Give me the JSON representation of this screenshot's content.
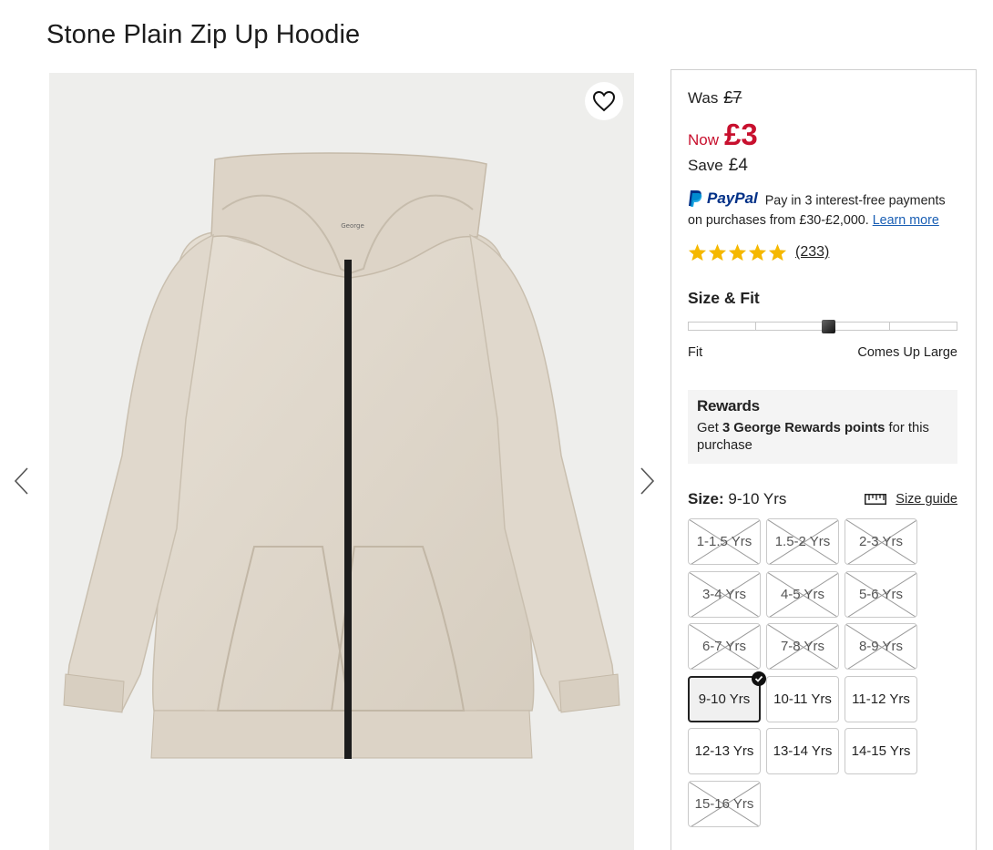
{
  "product": {
    "title": "Stone Plain Zip Up Hoodie",
    "brand_tag": "George"
  },
  "gallery": {
    "favourite_icon": "heart-icon",
    "prev_icon": "chevron-left-icon",
    "next_icon": "chevron-right-icon"
  },
  "price": {
    "was_label": "Was",
    "was_value": "£7",
    "now_label": "Now",
    "now_value": "£3",
    "save_label": "Save",
    "save_value": "£4",
    "sale_color": "#c8102e"
  },
  "paypal": {
    "logo_text": "PayPal",
    "message_line1": "Pay in 3 interest-free payments",
    "message_line2": "on purchases from £30-£2,000.",
    "link": "Learn more"
  },
  "rating": {
    "stars": 5,
    "count": "(233)",
    "star_color": "#f5b800"
  },
  "fit": {
    "title": "Size & Fit",
    "left_label": "Fit",
    "right_label": "Comes Up Large",
    "position_fraction": 0.52
  },
  "rewards": {
    "title": "Rewards",
    "text_pre": "Get ",
    "text_bold": "3 George Rewards points",
    "text_post": " for this purchase"
  },
  "size": {
    "label": "Size:",
    "selected": "9-10 Yrs",
    "guide_label": "Size guide",
    "guide_icon": "ruler-icon",
    "options": [
      {
        "label": "1-1.5 Yrs",
        "available": false
      },
      {
        "label": "1.5-2 Yrs",
        "available": false
      },
      {
        "label": "2-3 Yrs",
        "available": false
      },
      {
        "label": "3-4 Yrs",
        "available": false
      },
      {
        "label": "4-5 Yrs",
        "available": false
      },
      {
        "label": "5-6 Yrs",
        "available": false
      },
      {
        "label": "6-7 Yrs",
        "available": false
      },
      {
        "label": "7-8 Yrs",
        "available": false
      },
      {
        "label": "8-9 Yrs",
        "available": false
      },
      {
        "label": "9-10 Yrs",
        "available": true,
        "selected": true
      },
      {
        "label": "10-11 Yrs",
        "available": true
      },
      {
        "label": "11-12 Yrs",
        "available": true
      },
      {
        "label": "12-13 Yrs",
        "available": true
      },
      {
        "label": "13-14 Yrs",
        "available": true
      },
      {
        "label": "14-15 Yrs",
        "available": true
      },
      {
        "label": "15-16 Yrs",
        "available": false
      }
    ]
  }
}
